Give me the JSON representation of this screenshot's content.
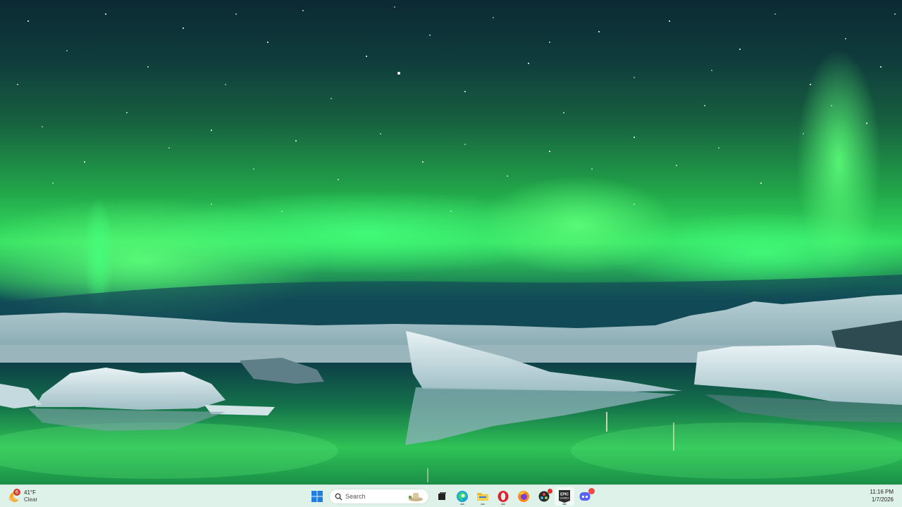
{
  "weather": {
    "badge_count": "6",
    "temperature": "41°F",
    "condition": "Clear"
  },
  "taskbar": {
    "search_placeholder": "Search",
    "apps": [
      {
        "name": "Start",
        "icon": "windows-logo-icon"
      },
      {
        "name": "Task View",
        "icon": "task-view-icon"
      },
      {
        "name": "Microsoft Edge",
        "icon": "edge-icon"
      },
      {
        "name": "File Explorer",
        "icon": "folder-icon"
      },
      {
        "name": "Opera",
        "icon": "opera-icon"
      },
      {
        "name": "Firefox",
        "icon": "firefox-icon"
      },
      {
        "name": "DaVinci Resolve",
        "icon": "davinci-icon"
      },
      {
        "name": "Epic Games Launcher",
        "icon": "epic-games-icon",
        "label": "EPIC\nGAMES"
      },
      {
        "name": "Discord",
        "icon": "discord-icon"
      }
    ],
    "epic_label": "EPIC",
    "epic_label2": "GAMES"
  },
  "clock": {
    "time": "11:16 PM",
    "date": "1/7/2026"
  },
  "colors": {
    "taskbar_bg": "#dff2ea",
    "aurora": "#35e061",
    "notification_red": "#d23a2c"
  }
}
